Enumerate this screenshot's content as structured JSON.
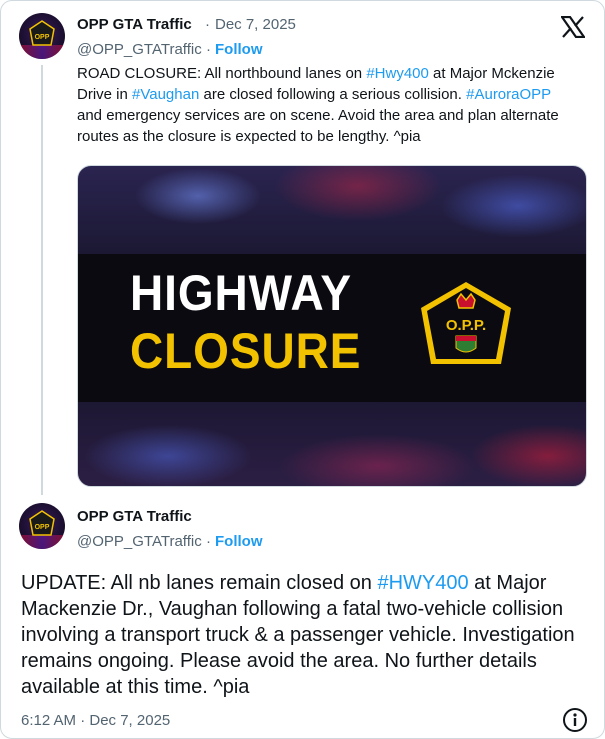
{
  "tweet1": {
    "display_name": "OPP GTA Traffic",
    "separator": "·",
    "date": "Dec 7, 2025",
    "handle": "@OPP_GTATraffic",
    "follow_label": "Follow",
    "text_parts": {
      "p1": "ROAD CLOSURE: All northbound lanes on ",
      "tag1": "#Hwy400",
      "p2": " at Major Mckenzie Drive in ",
      "tag2": "#Vaughan",
      "p3": " are closed following a serious collision. ",
      "tag3": "#AuroraOPP",
      "p4": " and emergency services are on scene. Avoid the area and plan alternate routes as the closure is expected to be lengthy. ^pia"
    },
    "media": {
      "line1": "HIGHWAY",
      "line2": "CLOSURE",
      "badge_text": "O.P.P."
    }
  },
  "tweet2": {
    "display_name": "OPP GTA Traffic",
    "separator": "·",
    "handle": "@OPP_GTATraffic",
    "follow_label": "Follow",
    "text_parts": {
      "p1": "UPDATE: All nb lanes remain closed on ",
      "tag1": "#HWY400",
      "p2": " at Major Mackenzie Dr., Vaughan following a fatal two-vehicle collision involving a transport truck & a passenger vehicle. Investigation remains ongoing. Please avoid the area. No further details available at this time. ^pia"
    },
    "timestamp": "6:12 AM · Dec 7, 2025"
  },
  "avatar_text": "OPP",
  "icons": {
    "platform": "x-logo-icon",
    "info": "info-icon"
  },
  "colors": {
    "link": "#1d9bf0",
    "text": "#0f1419",
    "muted": "#536471",
    "closure_yellow": "#f2c200"
  }
}
